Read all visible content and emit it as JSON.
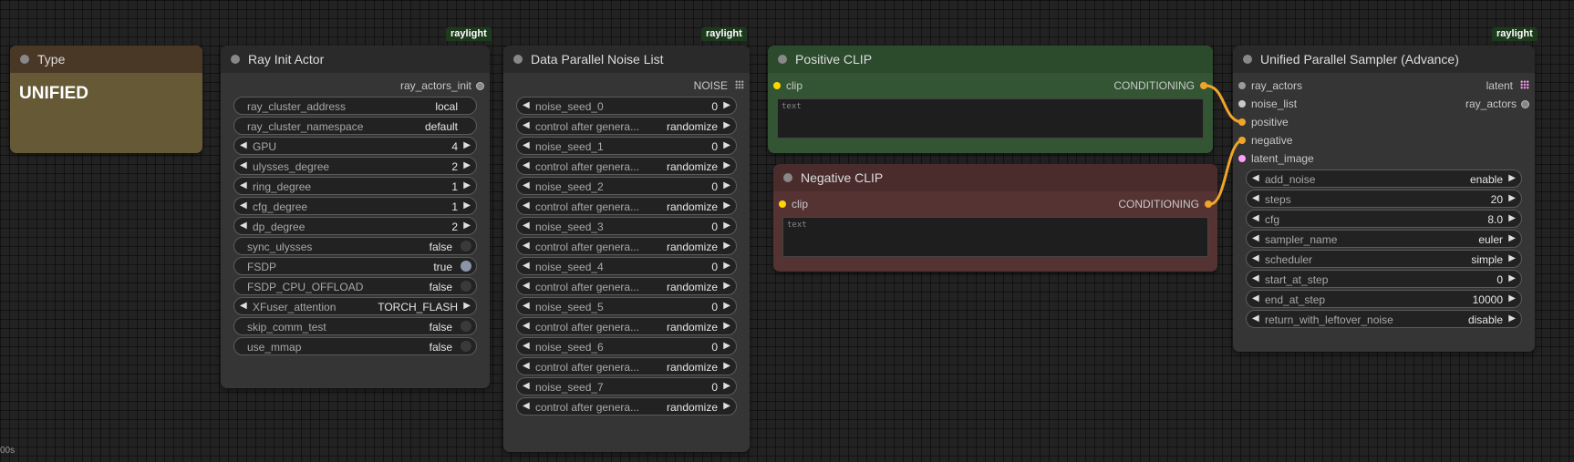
{
  "canvas": {
    "timer": "00s"
  },
  "type_node": {
    "title": "Type",
    "value": "UNIFIED"
  },
  "ray_init": {
    "badge": "raylight",
    "title": "Ray Init Actor",
    "output": "ray_actors_init",
    "widgets": [
      {
        "name": "ray_cluster_address",
        "value": "local"
      },
      {
        "name": "ray_cluster_namespace",
        "value": "default"
      },
      {
        "name": "GPU",
        "value": "4"
      },
      {
        "name": "ulysses_degree",
        "value": "2"
      },
      {
        "name": "ring_degree",
        "value": "1"
      },
      {
        "name": "cfg_degree",
        "value": "1"
      },
      {
        "name": "dp_degree",
        "value": "2"
      },
      {
        "name": "sync_ulysses",
        "value": "false"
      },
      {
        "name": "FSDP",
        "value": "true"
      },
      {
        "name": "FSDP_CPU_OFFLOAD",
        "value": "false"
      },
      {
        "name": "XFuser_attention",
        "value": "TORCH_FLASH"
      },
      {
        "name": "skip_comm_test",
        "value": "false"
      },
      {
        "name": "use_mmap",
        "value": "false"
      }
    ]
  },
  "noise_list": {
    "badge": "raylight",
    "title": "Data Parallel Noise List",
    "output": "NOISE",
    "widgets": [
      {
        "name": "noise_seed_0",
        "value": "0"
      },
      {
        "name": "control after genera...",
        "value": "randomize"
      },
      {
        "name": "noise_seed_1",
        "value": "0"
      },
      {
        "name": "control after genera...",
        "value": "randomize"
      },
      {
        "name": "noise_seed_2",
        "value": "0"
      },
      {
        "name": "control after genera...",
        "value": "randomize"
      },
      {
        "name": "noise_seed_3",
        "value": "0"
      },
      {
        "name": "control after genera...",
        "value": "randomize"
      },
      {
        "name": "noise_seed_4",
        "value": "0"
      },
      {
        "name": "control after genera...",
        "value": "randomize"
      },
      {
        "name": "noise_seed_5",
        "value": "0"
      },
      {
        "name": "control after genera...",
        "value": "randomize"
      },
      {
        "name": "noise_seed_6",
        "value": "0"
      },
      {
        "name": "control after genera...",
        "value": "randomize"
      },
      {
        "name": "noise_seed_7",
        "value": "0"
      },
      {
        "name": "control after genera...",
        "value": "randomize"
      }
    ]
  },
  "positive_clip": {
    "title": "Positive CLIP",
    "input": "clip",
    "output": "CONDITIONING",
    "placeholder": "text"
  },
  "negative_clip": {
    "title": "Negative CLIP",
    "input": "clip",
    "output": "CONDITIONING",
    "placeholder": "text"
  },
  "sampler": {
    "badge": "raylight",
    "title": "Unified Parallel Sampler (Advance)",
    "inputs": [
      "ray_actors",
      "noise_list",
      "positive",
      "negative",
      "latent_image"
    ],
    "outputs": [
      "latent",
      "ray_actors"
    ],
    "widgets": [
      {
        "name": "add_noise",
        "value": "enable"
      },
      {
        "name": "steps",
        "value": "20"
      },
      {
        "name": "cfg",
        "value": "8.0"
      },
      {
        "name": "sampler_name",
        "value": "euler"
      },
      {
        "name": "scheduler",
        "value": "simple"
      },
      {
        "name": "start_at_step",
        "value": "0"
      },
      {
        "name": "end_at_step",
        "value": "10000"
      },
      {
        "name": "return_with_leftover_noise",
        "value": "disable"
      }
    ]
  },
  "colors": {
    "canvas": "#222222",
    "node_bg": "#353535",
    "title_bg": "#2a2a2a",
    "type_node": "#655a35",
    "type_title": "#4a3826",
    "positive_body": "#335533",
    "positive_title": "#2c4a2c",
    "negative_body": "#553333",
    "negative_title": "#4a2c2c",
    "conditioning_link": "#f0a42a",
    "clip_port": "#ffd500",
    "latent_port": "#ff9cf9",
    "badge": "#1c3a1c"
  }
}
